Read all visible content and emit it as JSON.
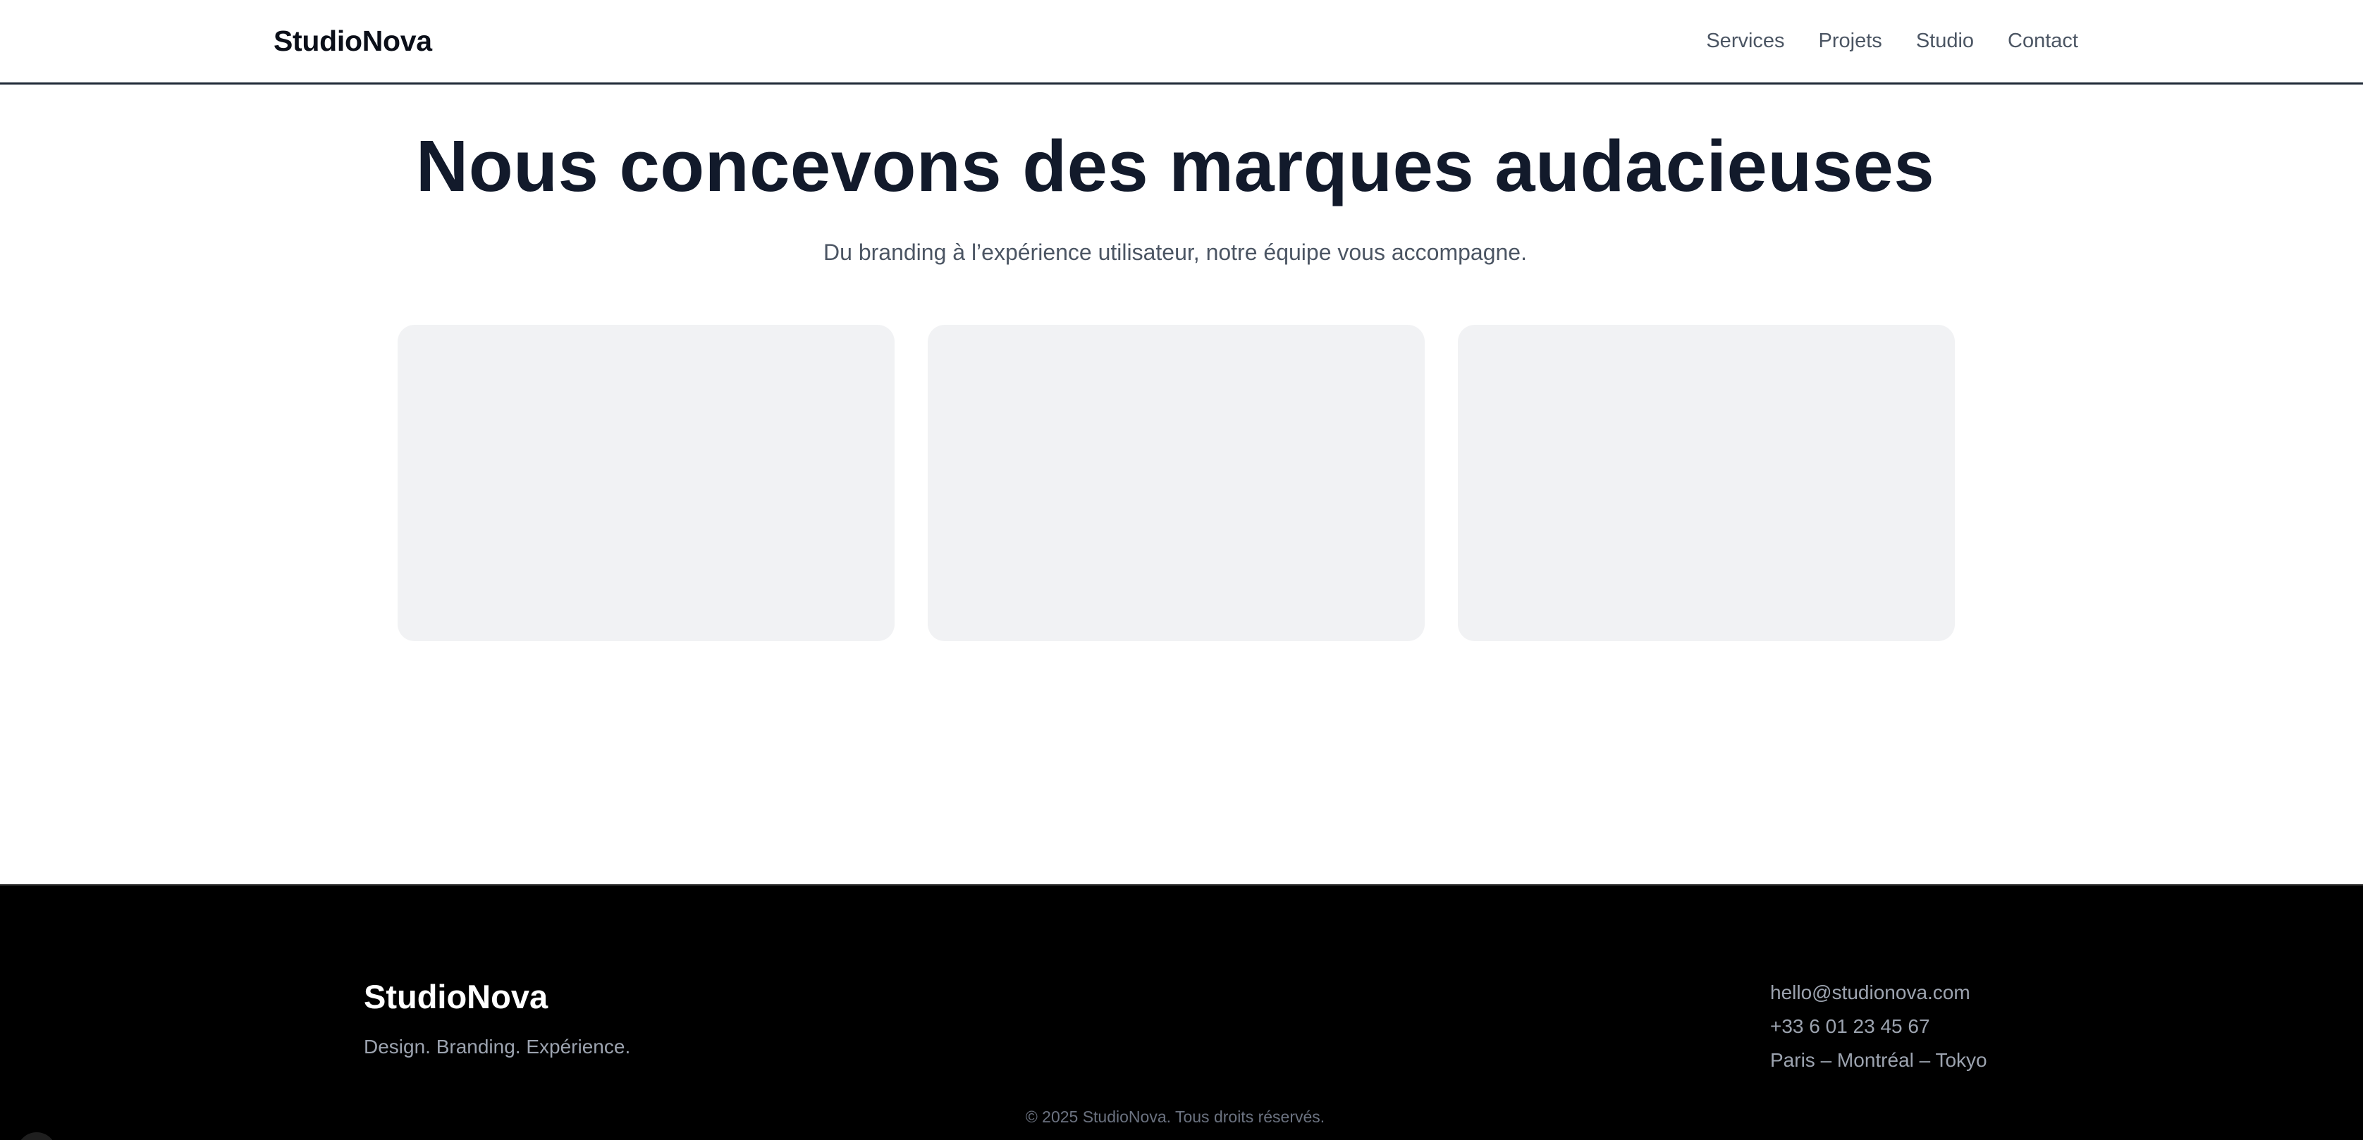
{
  "header": {
    "logo": "StudioNova",
    "nav": [
      "Services",
      "Projets",
      "Studio",
      "Contact"
    ]
  },
  "hero": {
    "title": "Nous concevons des marques audacieuses",
    "subtitle": "Du branding à l’expérience utilisateur, notre équipe vous accompagne."
  },
  "footer": {
    "brand": "StudioNova",
    "tagline": "Design. Branding. Expérience.",
    "email": "hello@studionova.com",
    "phone": "+33 6 01 23 45 67",
    "locations": "Paris – Montréal – Tokyo",
    "copyright": "© 2025 StudioNova. Tous droits réservés."
  },
  "colors": {
    "heading": "#121a2b",
    "body_text": "#4b5563",
    "card_bg": "#f1f2f4",
    "footer_bg": "#000000"
  }
}
